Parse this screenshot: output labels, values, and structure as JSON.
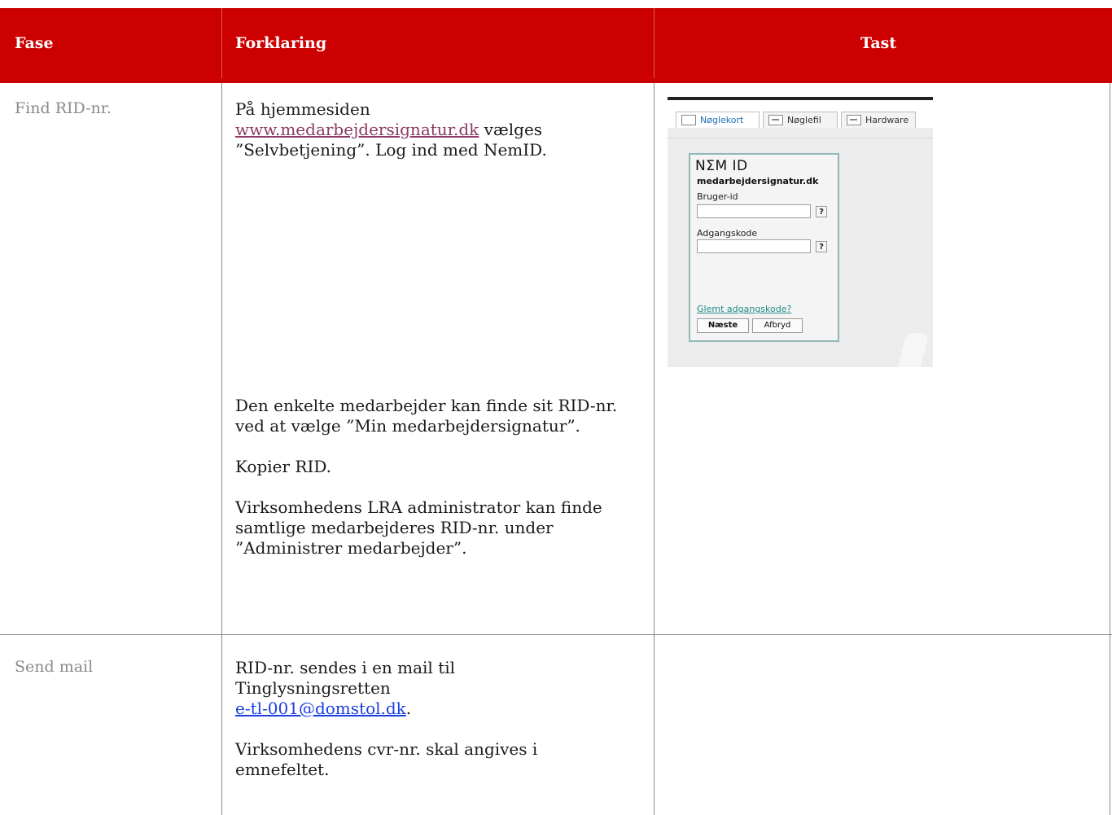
{
  "colors": {
    "header_bg": "#cc0000",
    "link": "#8c3a63",
    "email_link": "#1a3ee0"
  },
  "header": {
    "col1": "Fase",
    "col2": "Forklaring",
    "col3": "Tast"
  },
  "rows": [
    {
      "fase": "Find RID-nr.",
      "p1_pre": "På hjemmesiden",
      "p1_link": "www.medarbejdersignatur.dk",
      "p1_mid": " vælges",
      "p1_post": "”Selvbetjening”. Log ind med NemID.",
      "p2": "Den enkelte medarbejder kan finde sit RID-nr. ved at vælge ”Min medarbejdersignatur”.",
      "p3": "Kopier RID.",
      "p4": "Virksomhedens LRA administrator kan finde samtlige medarbejderes RID-nr. under ”Administrer medarbejder”."
    },
    {
      "fase": "Send mail",
      "p1": "RID-nr. sendes i en mail til Tinglysningsretten",
      "p1_link": "e-tl-001@domstol.dk",
      "p1_end": ".",
      "p2": "Virksomhedens cvr-nr.  skal angives i emnefeltet."
    }
  ],
  "nemid": {
    "tabs": [
      "Nøglekort",
      "Nøglefil",
      "Hardware"
    ],
    "logo": "NΣM ID",
    "site": "medarbejdersignatur.dk",
    "user_label": "Bruger-id",
    "password_label": "Adgangskode",
    "help": "?",
    "forgot": "Glemt adgangskode?",
    "next_button": "Næste",
    "cancel_button": "Afbryd"
  }
}
